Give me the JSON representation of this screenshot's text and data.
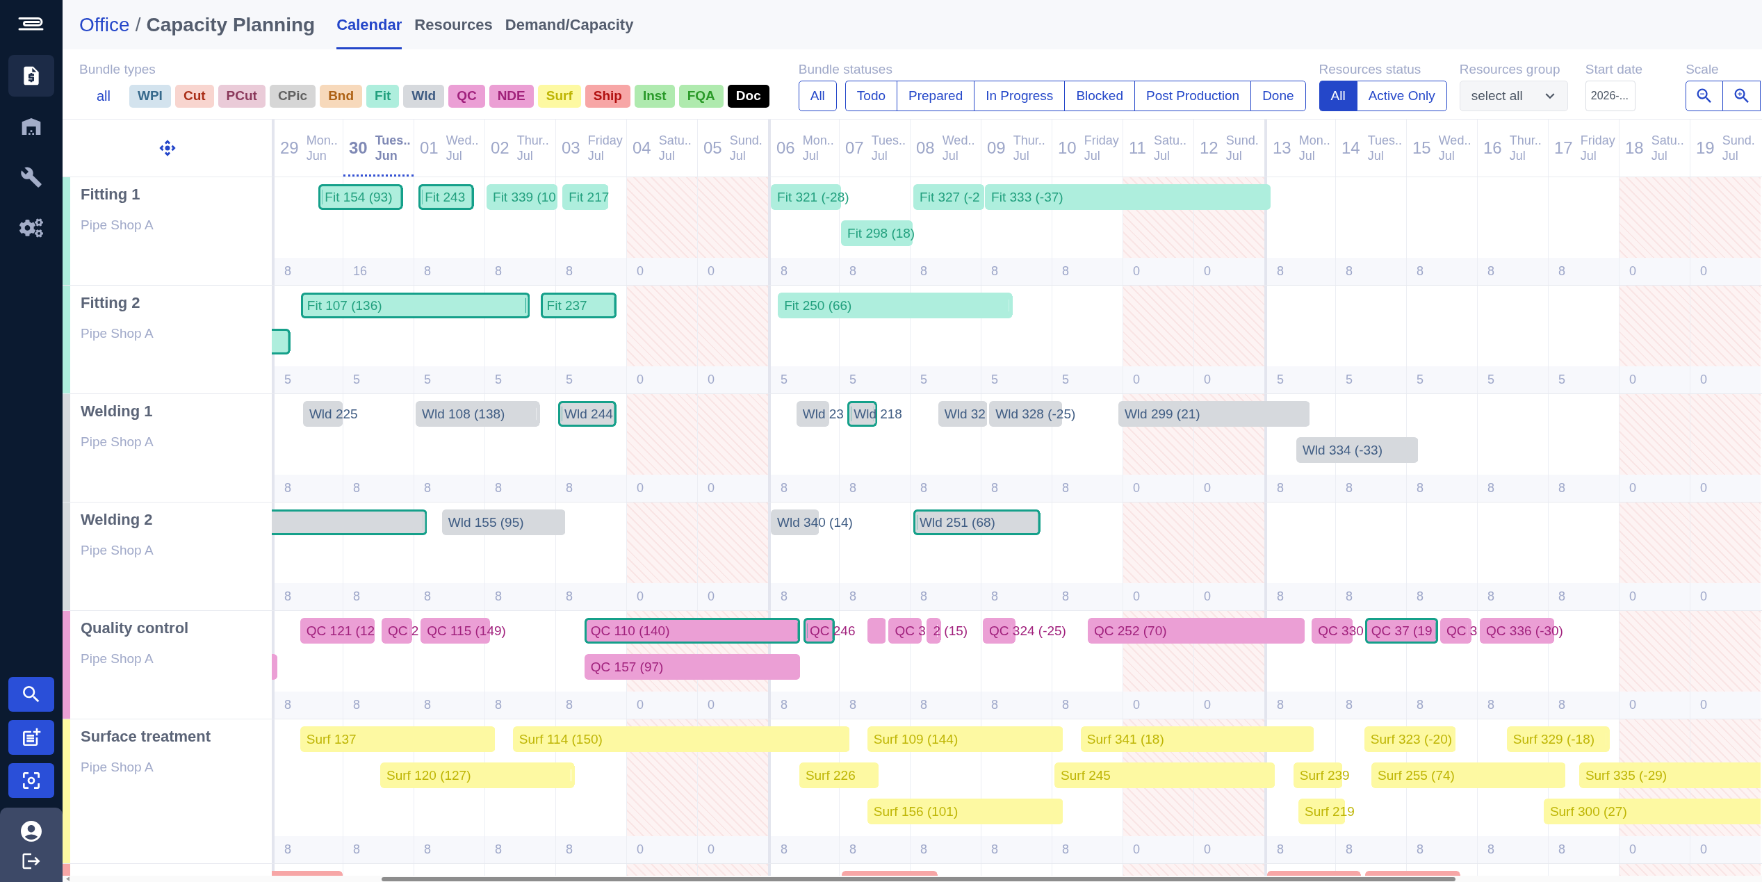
{
  "sidebar": {
    "nav_items": [
      {
        "selected": true
      },
      {
        "selected": false
      },
      {
        "selected": false
      },
      {
        "selected": false
      }
    ]
  },
  "header": {
    "breadcrumb": {
      "parent": "Office",
      "separator": "/",
      "title": "Capacity Planning"
    },
    "tabs": [
      {
        "label": "Calendar",
        "selected": true
      },
      {
        "label": "Resources",
        "selected": false
      },
      {
        "label": "Demand/Capacity",
        "selected": false
      }
    ]
  },
  "filters": {
    "bundle_types": {
      "label": "Bundle types",
      "all_link": "all",
      "chips": [
        {
          "label": "WPI",
          "color": "#d3e3ee"
        },
        {
          "label": "Cut",
          "color": "#f8d5cf"
        },
        {
          "label": "PCut",
          "color": "#eacbd8"
        },
        {
          "label": "CPic",
          "color": "#d6d6d6"
        },
        {
          "label": "Bnd",
          "color": "#f7d9bb"
        },
        {
          "label": "Fit",
          "color": "#aeeedd"
        },
        {
          "label": "Wld",
          "color": "#d6d9dd"
        },
        {
          "label": "QC",
          "color": "#eb9fd5"
        },
        {
          "label": "NDE",
          "color": "#eb9fd4"
        },
        {
          "label": "Surf",
          "color": "#fdf9a2"
        },
        {
          "label": "Ship",
          "color": "#f7a6a6"
        },
        {
          "label": "Inst",
          "color": "#afeaaf"
        },
        {
          "label": "FQA",
          "color": "#afeaae"
        },
        {
          "label": "Doc",
          "color": "#000000"
        }
      ]
    },
    "bundle_statuses": {
      "label": "Bundle statuses",
      "all": {
        "label": "All",
        "selected": false
      },
      "options": [
        {
          "label": "Todo",
          "selected": false
        },
        {
          "label": "Prepared",
          "selected": false
        },
        {
          "label": "In Progress",
          "selected": false
        },
        {
          "label": "Blocked",
          "selected": false
        },
        {
          "label": "Post Production",
          "selected": false
        },
        {
          "label": "Done",
          "selected": false
        }
      ]
    },
    "resources_status": {
      "label": "Resources status",
      "options": [
        {
          "label": "All",
          "selected": true
        },
        {
          "label": "Active Only",
          "selected": false
        }
      ]
    },
    "resources_group": {
      "label": "Resources group",
      "value": "select all"
    },
    "start_date": {
      "label": "Start date",
      "value": "2026-..."
    },
    "scale": {
      "label": "Scale"
    }
  },
  "calendar": {
    "days": [
      {
        "day": "29",
        "weekday": "Mon..",
        "month": "Jun",
        "today": false,
        "weekend": false,
        "week_start": true
      },
      {
        "day": "30",
        "weekday": "Tues..",
        "month": "Jun",
        "today": true,
        "weekend": false,
        "week_start": false
      },
      {
        "day": "01",
        "weekday": "Wed..",
        "month": "Jul",
        "today": false,
        "weekend": false,
        "week_start": false
      },
      {
        "day": "02",
        "weekday": "Thur..",
        "month": "Jul",
        "today": false,
        "weekend": false,
        "week_start": false
      },
      {
        "day": "03",
        "weekday": "Friday",
        "month": "Jul",
        "today": false,
        "weekend": false,
        "week_start": false
      },
      {
        "day": "04",
        "weekday": "Satu..",
        "month": "Jul",
        "today": false,
        "weekend": true,
        "week_start": false
      },
      {
        "day": "05",
        "weekday": "Sund.",
        "month": "Jul",
        "today": false,
        "weekend": true,
        "week_start": false
      },
      {
        "day": "06",
        "weekday": "Mon..",
        "month": "Jul",
        "today": false,
        "weekend": false,
        "week_start": true
      },
      {
        "day": "07",
        "weekday": "Tues..",
        "month": "Jul",
        "today": false,
        "weekend": false,
        "week_start": false
      },
      {
        "day": "08",
        "weekday": "Wed..",
        "month": "Jul",
        "today": false,
        "weekend": false,
        "week_start": false
      },
      {
        "day": "09",
        "weekday": "Thur..",
        "month": "Jul",
        "today": false,
        "weekend": false,
        "week_start": false
      },
      {
        "day": "10",
        "weekday": "Friday",
        "month": "Jul",
        "today": false,
        "weekend": false,
        "week_start": false
      },
      {
        "day": "11",
        "weekday": "Satu..",
        "month": "Jul",
        "today": false,
        "weekend": true,
        "week_start": false
      },
      {
        "day": "12",
        "weekday": "Sund.",
        "month": "Jul",
        "today": false,
        "weekend": true,
        "week_start": false
      },
      {
        "day": "13",
        "weekday": "Mon..",
        "month": "Jul",
        "today": false,
        "weekend": false,
        "week_start": true
      },
      {
        "day": "14",
        "weekday": "Tues..",
        "month": "Jul",
        "today": false,
        "weekend": false,
        "week_start": false
      },
      {
        "day": "15",
        "weekday": "Wed..",
        "month": "Jul",
        "today": false,
        "weekend": false,
        "week_start": false
      },
      {
        "day": "16",
        "weekday": "Thur..",
        "month": "Jul",
        "today": false,
        "weekend": false,
        "week_start": false
      },
      {
        "day": "17",
        "weekday": "Friday",
        "month": "Jul",
        "today": false,
        "weekend": false,
        "week_start": false
      },
      {
        "day": "18",
        "weekday": "Satu..",
        "month": "Jul",
        "today": false,
        "weekend": true,
        "week_start": false
      },
      {
        "day": "19",
        "weekday": "Sund.",
        "month": "Jul",
        "today": false,
        "weekend": true,
        "week_start": false
      }
    ],
    "resources": [
      {
        "name": "Fitting 1",
        "location": "Pipe Shop A",
        "color": "#aeeedd",
        "lanes": [
          [
            {
              "label": "Fit 154 (93)",
              "highlighted": true
            },
            {
              "label": "Fit 243",
              "highlighted": true
            },
            {
              "label": "Fit 339 (10",
              "highlighted": false
            },
            {
              "label": "Fit 217",
              "highlighted": false
            },
            {
              "label": "Fit 321 (-28)",
              "highlighted": false
            },
            {
              "label": "Fit 327 (-2",
              "highlighted": false
            },
            {
              "label": "Fit 333 (-37)",
              "highlighted": false
            }
          ],
          [
            {
              "label": "Fit 298 (18)",
              "highlighted": false
            }
          ]
        ],
        "capacity": [
          "8",
          "16",
          "8",
          "8",
          "8",
          "0",
          "0",
          "8",
          "8",
          "8",
          "8",
          "8",
          "0",
          "0",
          "8",
          "8",
          "8",
          "8",
          "8",
          "0",
          "0"
        ]
      },
      {
        "name": "Fitting 2",
        "location": "Pipe Shop A",
        "color": "#aeeedd",
        "lanes": [
          [
            {
              "label": "Fit 107 (136)",
              "highlighted": true
            },
            {
              "label": "Fit 237",
              "highlighted": true
            },
            {
              "label": "Fit 250 (66)",
              "highlighted": false
            }
          ],
          [
            {
              "highlighted": true
            }
          ]
        ],
        "capacity": [
          "5",
          "5",
          "5",
          "5",
          "5",
          "0",
          "0",
          "5",
          "5",
          "5",
          "5",
          "5",
          "0",
          "0",
          "5",
          "5",
          "5",
          "5",
          "5",
          "0",
          "0"
        ]
      },
      {
        "name": "Welding 1",
        "location": "Pipe Shop A",
        "color": "#d6d9dd",
        "lanes": [
          [
            {
              "label": "Wld 225",
              "highlighted": false
            },
            {
              "label": "Wld 108 (138)",
              "highlighted": false
            },
            {
              "label": "Wld 244",
              "highlighted": true
            },
            {
              "label": "Wld 23",
              "highlighted": false
            },
            {
              "label": "Wld 218",
              "highlighted": true
            },
            {
              "label": "Wld 32",
              "highlighted": false
            },
            {
              "label": "Wld 328 (-25)",
              "highlighted": false
            },
            {
              "label": "Wld 299 (21)",
              "highlighted": false
            }
          ],
          [
            {
              "label": "Wld 334 (-33)",
              "highlighted": false
            }
          ]
        ],
        "capacity": [
          "8",
          "8",
          "8",
          "8",
          "8",
          "0",
          "0",
          "8",
          "8",
          "8",
          "8",
          "8",
          "0",
          "0",
          "8",
          "8",
          "8",
          "8",
          "8",
          "0",
          "0"
        ]
      },
      {
        "name": "Welding 2",
        "location": "Pipe Shop A",
        "color": "#d6d9dd",
        "lanes": [
          [
            {
              "highlighted": true
            },
            {
              "label": "Wld 155 (95)",
              "highlighted": false
            },
            {
              "label": "Wld 340 (14)",
              "highlighted": false
            },
            {
              "label": "Wld 251 (68)",
              "highlighted": true
            }
          ]
        ],
        "capacity": [
          "8",
          "8",
          "8",
          "8",
          "8",
          "0",
          "0",
          "8",
          "8",
          "8",
          "8",
          "8",
          "0",
          "0",
          "8",
          "8",
          "8",
          "8",
          "8",
          "0",
          "0"
        ]
      },
      {
        "name": "Quality control",
        "location": "Pipe Shop A",
        "color": "#eb9fd5",
        "lanes": [
          [
            {
              "label": "QC 121 (12",
              "highlighted": false
            },
            {
              "label": "QC 2",
              "highlighted": false
            },
            {
              "label": "QC 115 (149)",
              "highlighted": false
            },
            {
              "label": "QC 110 (140)",
              "highlighted": true
            },
            {
              "label": "QC 246",
              "highlighted": true
            },
            {
              "highlighted": false
            },
            {
              "label": "QC 3",
              "highlighted": false
            },
            {
              "label": "2 (15)",
              "highlighted": false
            },
            {
              "label": "QC 324 (-25)",
              "highlighted": false
            },
            {
              "label": "QC 252 (70)",
              "highlighted": false
            },
            {
              "label": "QC 330",
              "highlighted": false
            },
            {
              "label": "QC 37 (19",
              "highlighted": true
            },
            {
              "label": "QC 3",
              "highlighted": false
            },
            {
              "label": "QC 336 (-30)",
              "highlighted": false
            }
          ],
          [
            {
              "highlighted": false
            },
            {
              "label": "QC 157 (97)",
              "highlighted": false
            }
          ]
        ],
        "capacity": [
          "8",
          "8",
          "8",
          "8",
          "8",
          "0",
          "0",
          "8",
          "8",
          "8",
          "8",
          "8",
          "0",
          "0",
          "8",
          "8",
          "8",
          "8",
          "8",
          "0",
          "0"
        ]
      },
      {
        "name": "Surface treatment",
        "location": "Pipe Shop A",
        "color": "#fdf9a2",
        "lanes": [
          [
            {
              "label": "Surf 137",
              "highlighted": false
            },
            {
              "label": "Surf 114 (150)",
              "highlighted": false
            },
            {
              "label": "Surf 109 (144)",
              "highlighted": false
            },
            {
              "label": "Surf 341 (18)",
              "highlighted": false
            },
            {
              "label": "Surf 323 (-20)",
              "highlighted": false
            },
            {
              "label": "Surf 329 (-18)",
              "highlighted": false
            }
          ],
          [
            {
              "label": "Surf 120 (127)",
              "highlighted": false
            },
            {
              "label": "Surf 226",
              "highlighted": false
            },
            {
              "label": "Surf 245",
              "highlighted": false
            },
            {
              "label": "Surf 239",
              "highlighted": false
            },
            {
              "label": "Surf 255 (74)",
              "highlighted": false
            },
            {
              "label": "Surf 335 (-29)",
              "highlighted": false
            }
          ],
          [
            {
              "label": "Surf 156 (101)",
              "highlighted": false
            },
            {
              "label": "Surf 219",
              "highlighted": false
            },
            {
              "label": "Surf 300 (27)",
              "highlighted": false
            }
          ]
        ],
        "capacity": [
          "8",
          "8",
          "8",
          "8",
          "8",
          "0",
          "0",
          "8",
          "8",
          "8",
          "8",
          "8",
          "0",
          "0",
          "8",
          "8",
          "8",
          "8",
          "8",
          "0",
          "0"
        ]
      },
      {
        "color": "#f7a6a6",
        "lanes": [
          [
            {
              "highlighted": false
            },
            {
              "highlighted": false
            },
            {
              "highlighted": false
            },
            {
              "highlighted": false
            }
          ]
        ]
      }
    ]
  }
}
